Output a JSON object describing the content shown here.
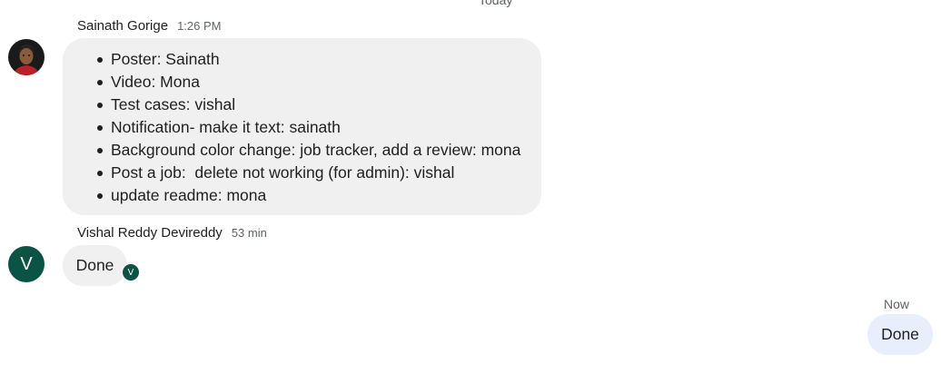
{
  "day_separator": "Today",
  "messages": [
    {
      "sender": "Sainath Gorige",
      "time": "1:26 PM",
      "items": [
        "Poster: Sainath",
        "Video: Mona",
        "Test cases: vishal",
        "Notification- make it text: sainath",
        "Background color change: job tracker, add a review: mona",
        "Post a job:  delete not working (for admin): vishal",
        "update readme: mona"
      ]
    },
    {
      "sender": "Vishal Reddy Devireddy",
      "time": "53 min",
      "avatar_letter": "V",
      "text": "Done",
      "read_receipt_letter": "V"
    },
    {
      "sender": "self",
      "time": "Now",
      "text": "Done"
    }
  ],
  "colors": {
    "incoming_bubble": "#f0f0f0",
    "outgoing_bubble": "#e8eefb",
    "avatar_green": "#0b5345"
  }
}
